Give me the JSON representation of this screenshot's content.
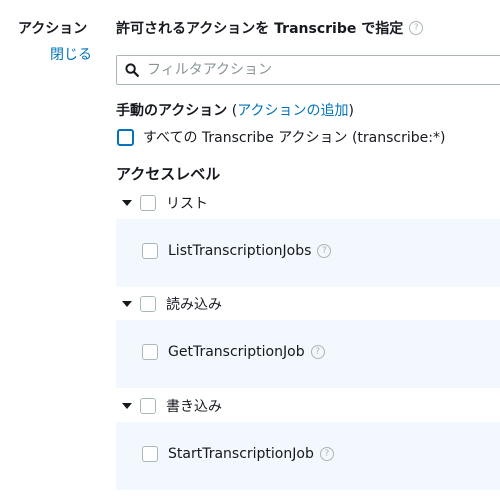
{
  "left": {
    "label": "アクション",
    "close": "閉じる"
  },
  "heading": {
    "text": "許可されるアクションを Transcribe で指定",
    "info": "?"
  },
  "filter": {
    "placeholder": "フィルタアクション",
    "value": ""
  },
  "manual": {
    "title": "手動のアクション",
    "open_paren": " (",
    "link": "アクションの追加",
    "close_paren": ")"
  },
  "all_actions": {
    "label": "すべての Transcribe アクション (transcribe:*)",
    "checked": false
  },
  "access_level": {
    "title": "アクセスレベル",
    "groups": [
      {
        "label": "リスト",
        "actions": [
          {
            "label": "ListTranscriptionJobs",
            "info": "?"
          }
        ]
      },
      {
        "label": "読み込み",
        "actions": [
          {
            "label": "GetTranscriptionJob",
            "info": "?"
          }
        ]
      },
      {
        "label": "書き込み",
        "actions": [
          {
            "label": "StartTranscriptionJob",
            "info": "?"
          }
        ]
      }
    ]
  },
  "colors": {
    "link": "#0073bb",
    "panel_bg": "#f2f8fd",
    "border": "#aab7b8",
    "text": "#16191f"
  }
}
